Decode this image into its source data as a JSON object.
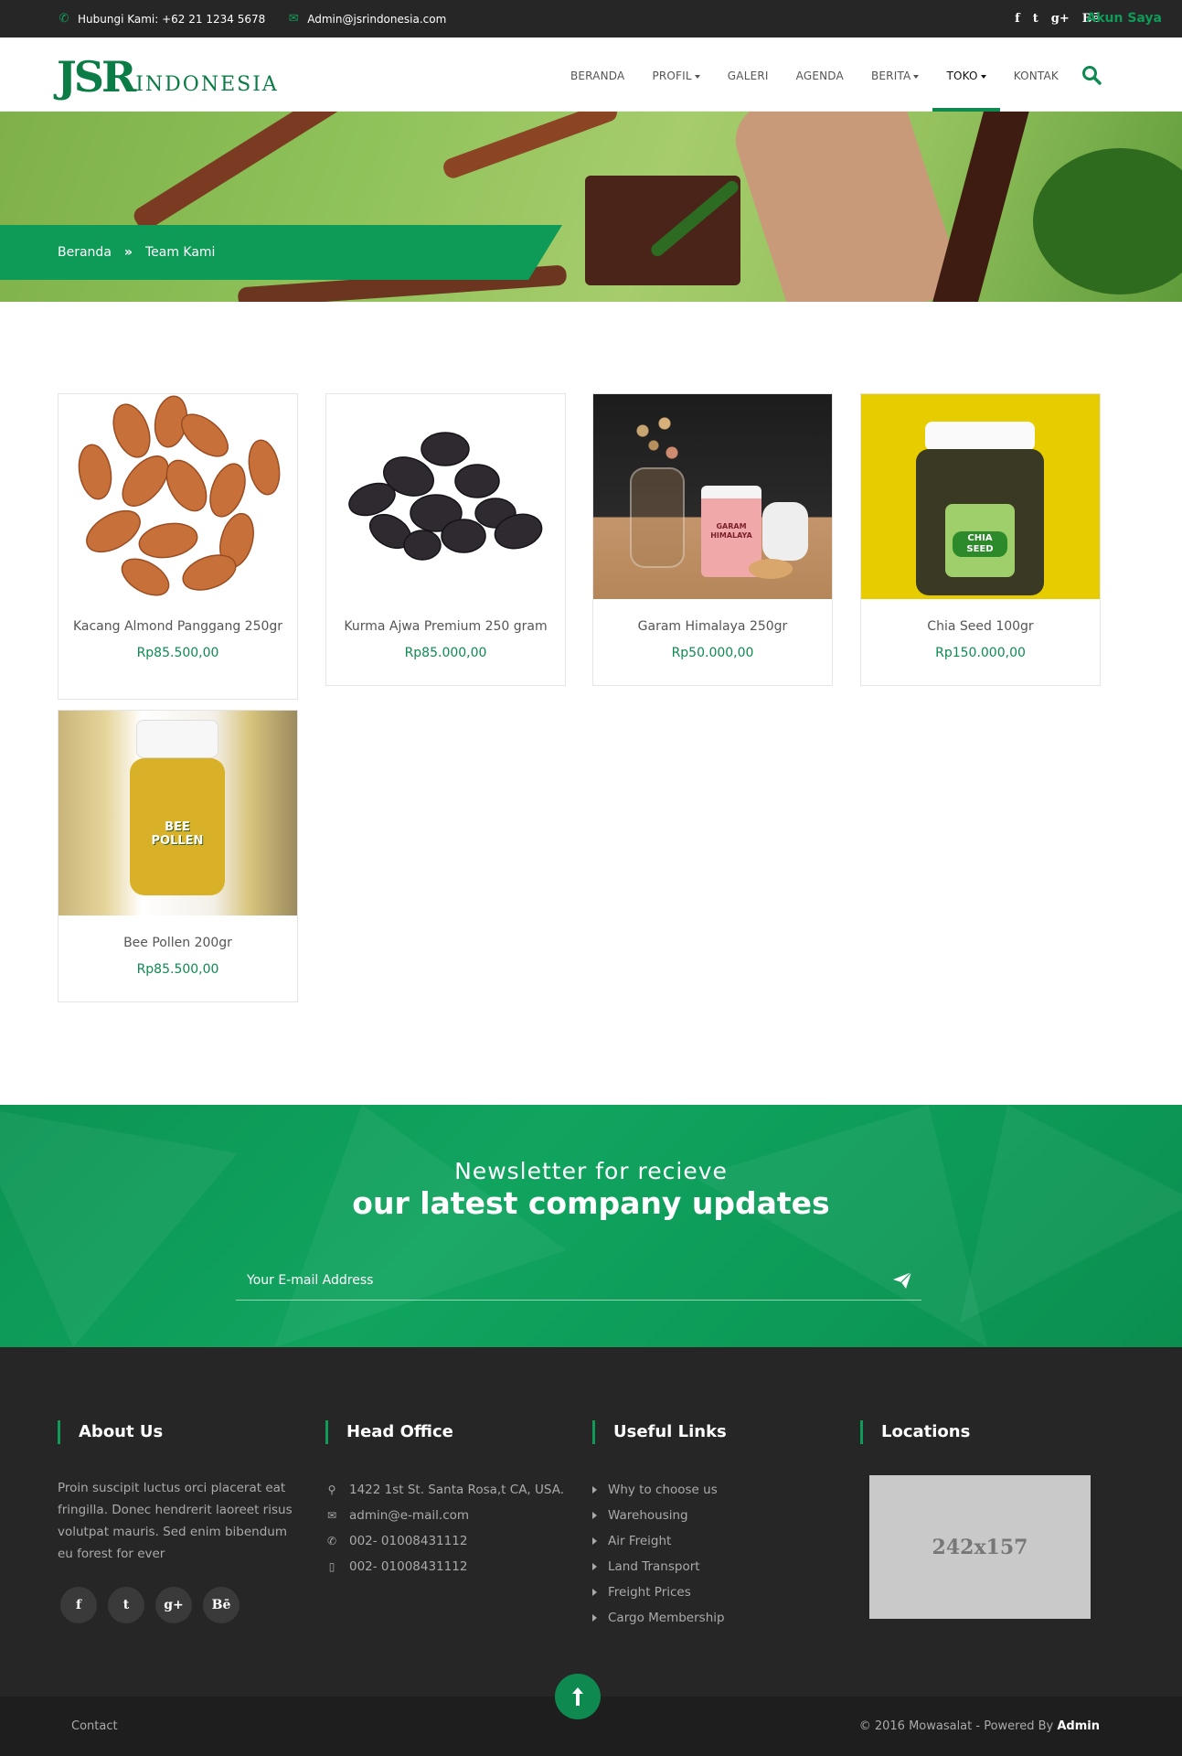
{
  "topbar": {
    "phone": "Hubungi Kami: +62 21 1234 5678",
    "email": "Admin@jsrindonesia.com",
    "social": [
      "f",
      "t",
      "g+",
      "Bē"
    ],
    "account": "Akun Saya"
  },
  "logo": {
    "mark": "JSR",
    "name": "INDONESIA"
  },
  "nav": {
    "items": [
      {
        "label": "BERANDA"
      },
      {
        "label": "PROFIL"
      },
      {
        "label": "GALERI"
      },
      {
        "label": "AGENDA"
      },
      {
        "label": "BERITA"
      },
      {
        "label": "TOKO"
      },
      {
        "label": "KONTAK"
      }
    ]
  },
  "breadcrumb": {
    "home": "Beranda",
    "sep": "»",
    "current": "Team Kami"
  },
  "products": [
    {
      "title": "Kacang Almond Panggang 250gr",
      "price": "Rp85.500,00"
    },
    {
      "title": "Kurma Ajwa Premium 250 gram",
      "price": "Rp85.000,00"
    },
    {
      "title": "Garam Himalaya 250gr",
      "price": "Rp50.000,00"
    },
    {
      "title": "Chia Seed 100gr",
      "price": "Rp150.000,00"
    },
    {
      "title": "Bee Pollen 200gr",
      "price": "Rp85.500,00"
    }
  ],
  "product_labels": {
    "chia": "CHIA SEED",
    "bee": "BEE POLLEN",
    "garam": "GARAM HIMALAYA"
  },
  "newsletter": {
    "line1": "Newsletter for recieve",
    "line2": "our latest company updates",
    "placeholder": "Your E-mail Address"
  },
  "footer": {
    "about": {
      "heading": "About Us",
      "text": "Proin suscipit luctus orci placerat eat fringilla. Donec hendrerit laoreet risus volutpat mauris. Sed enim bibendum eu forest for ever",
      "social": [
        "f",
        "t",
        "g+",
        "Bē"
      ]
    },
    "office": {
      "heading": "Head Office",
      "address": "1422 1st St. Santa Rosa,t CA, USA.",
      "email": "admin@e-mail.com",
      "phone": "002- 01008431112",
      "mobile": "002- 01008431112"
    },
    "links": {
      "heading": "Useful Links",
      "items": [
        "Why to choose us",
        "Warehousing",
        "Air Freight",
        "Land Transport",
        "Freight Prices",
        "Cargo Membership"
      ]
    },
    "locations": {
      "heading": "Locations",
      "map_label": "242x157"
    }
  },
  "bottom": {
    "contact": "Contact",
    "copyright": "© 2016 Mowasalat - Powered By",
    "powered": "Admin"
  }
}
